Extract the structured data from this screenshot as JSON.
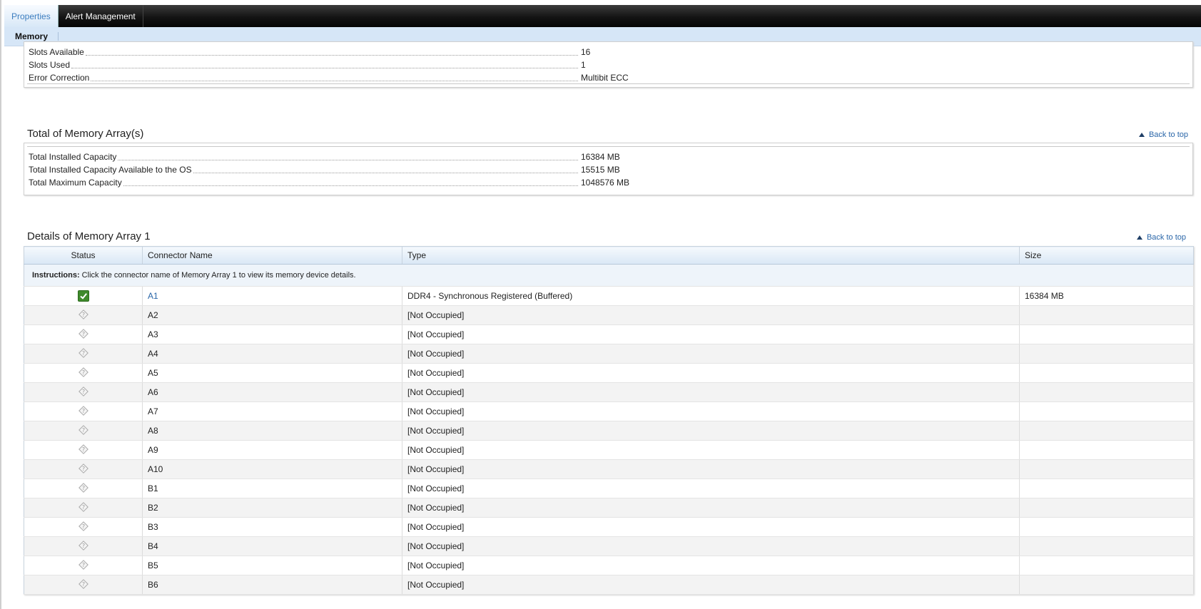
{
  "tabs": [
    {
      "label": "Properties",
      "active": true
    },
    {
      "label": "Alert Management",
      "active": false
    }
  ],
  "subtabs": [
    {
      "label": "Memory"
    }
  ],
  "array_props": [
    {
      "label": "Slots Available",
      "value": "16"
    },
    {
      "label": "Slots Used",
      "value": "1"
    },
    {
      "label": "Error Correction",
      "value": "Multibit ECC"
    }
  ],
  "total_section": {
    "title": "Total of Memory Array(s)",
    "back_to_top": "Back to top",
    "rows": [
      {
        "label": "Total Installed Capacity",
        "value": "16384 MB"
      },
      {
        "label": "Total Installed Capacity Available to the OS",
        "value": "15515 MB"
      },
      {
        "label": "Total Maximum Capacity",
        "value": "1048576 MB"
      }
    ]
  },
  "details_section": {
    "title": "Details of Memory Array 1",
    "back_to_top": "Back to top",
    "columns": [
      "Status",
      "Connector Name",
      "Type",
      "Size"
    ],
    "instructions_label": "Instructions:",
    "instructions_text": " Click the connector name of Memory Array 1 to view its memory device details.",
    "rows": [
      {
        "status": "ok",
        "connector": "A1",
        "type": "DDR4 - Synchronous Registered (Buffered)",
        "size": "16384 MB",
        "link": true
      },
      {
        "status": "unknown",
        "connector": "A2",
        "type": "[Not Occupied]",
        "size": ""
      },
      {
        "status": "unknown",
        "connector": "A3",
        "type": "[Not Occupied]",
        "size": ""
      },
      {
        "status": "unknown",
        "connector": "A4",
        "type": "[Not Occupied]",
        "size": ""
      },
      {
        "status": "unknown",
        "connector": "A5",
        "type": "[Not Occupied]",
        "size": ""
      },
      {
        "status": "unknown",
        "connector": "A6",
        "type": "[Not Occupied]",
        "size": ""
      },
      {
        "status": "unknown",
        "connector": "A7",
        "type": "[Not Occupied]",
        "size": ""
      },
      {
        "status": "unknown",
        "connector": "A8",
        "type": "[Not Occupied]",
        "size": ""
      },
      {
        "status": "unknown",
        "connector": "A9",
        "type": "[Not Occupied]",
        "size": ""
      },
      {
        "status": "unknown",
        "connector": "A10",
        "type": "[Not Occupied]",
        "size": ""
      },
      {
        "status": "unknown",
        "connector": "B1",
        "type": "[Not Occupied]",
        "size": ""
      },
      {
        "status": "unknown",
        "connector": "B2",
        "type": "[Not Occupied]",
        "size": ""
      },
      {
        "status": "unknown",
        "connector": "B3",
        "type": "[Not Occupied]",
        "size": ""
      },
      {
        "status": "unknown",
        "connector": "B4",
        "type": "[Not Occupied]",
        "size": ""
      },
      {
        "status": "unknown",
        "connector": "B5",
        "type": "[Not Occupied]",
        "size": ""
      },
      {
        "status": "unknown",
        "connector": "B6",
        "type": "[Not Occupied]",
        "size": ""
      }
    ]
  },
  "icons": {
    "ok": "check-icon",
    "unknown": "unknown-status-icon"
  },
  "colors": {
    "link": "#2a66a8",
    "ok_green": "#3f8a2c",
    "subbar": "#d6e6f7"
  }
}
